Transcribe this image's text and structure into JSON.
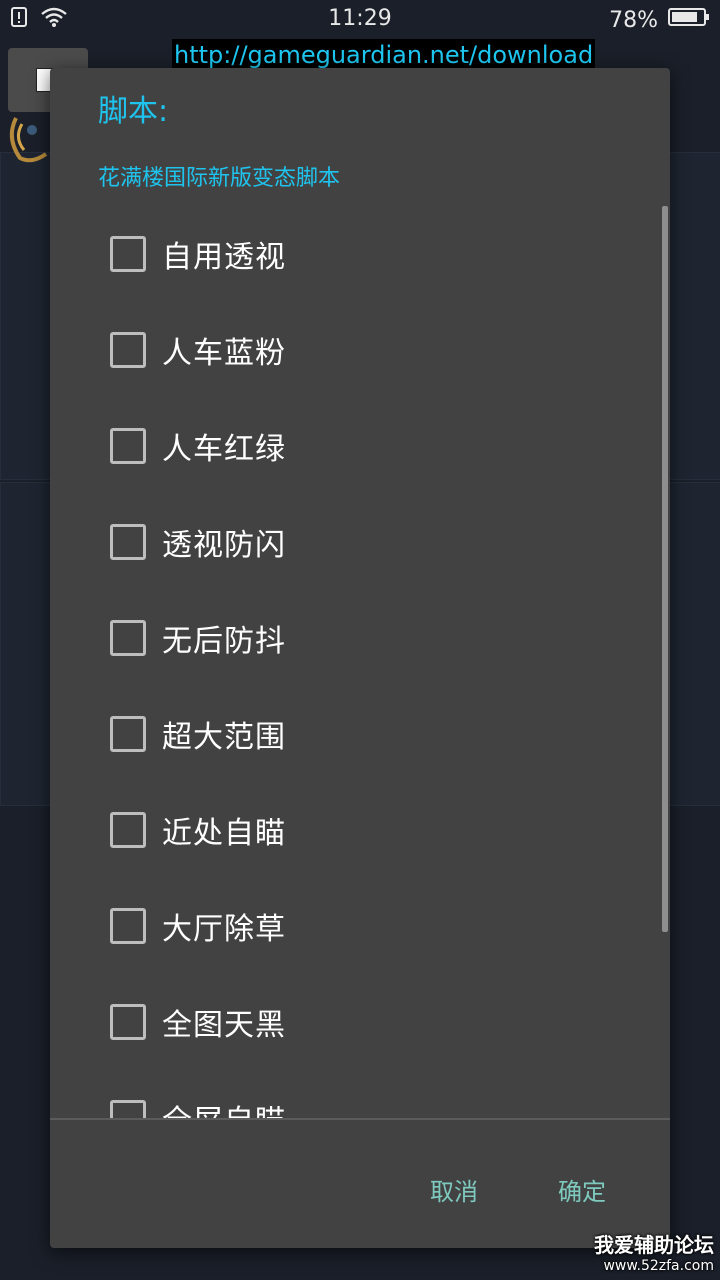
{
  "status_bar": {
    "time": "11:29",
    "battery": "78%",
    "icons": [
      "sim-alert-icon",
      "wifi-icon",
      "battery-icon"
    ]
  },
  "overlay": {
    "url": "http://gameguardian.net/download"
  },
  "dialog": {
    "title": "脚本:",
    "subtitle": "花满楼国际新版变态脚本",
    "items": [
      {
        "label": "自用透视",
        "checked": false
      },
      {
        "label": "人车蓝粉",
        "checked": false
      },
      {
        "label": "人车红绿",
        "checked": false
      },
      {
        "label": "透视防闪",
        "checked": false
      },
      {
        "label": "无后防抖",
        "checked": false
      },
      {
        "label": "超大范围",
        "checked": false
      },
      {
        "label": "近处自瞄",
        "checked": false
      },
      {
        "label": "大厅除草",
        "checked": false
      },
      {
        "label": "全图天黑",
        "checked": false
      },
      {
        "label": "全屏自瞄",
        "checked": false
      }
    ],
    "cancel_label": "取消",
    "ok_label": "确定"
  },
  "watermark": {
    "main": "我爱辅助论坛",
    "site": "www.52zfa.com"
  },
  "colors": {
    "accent": "#1fc4ee",
    "button_text": "#7fcabf",
    "dialog_bg": "#424242"
  }
}
